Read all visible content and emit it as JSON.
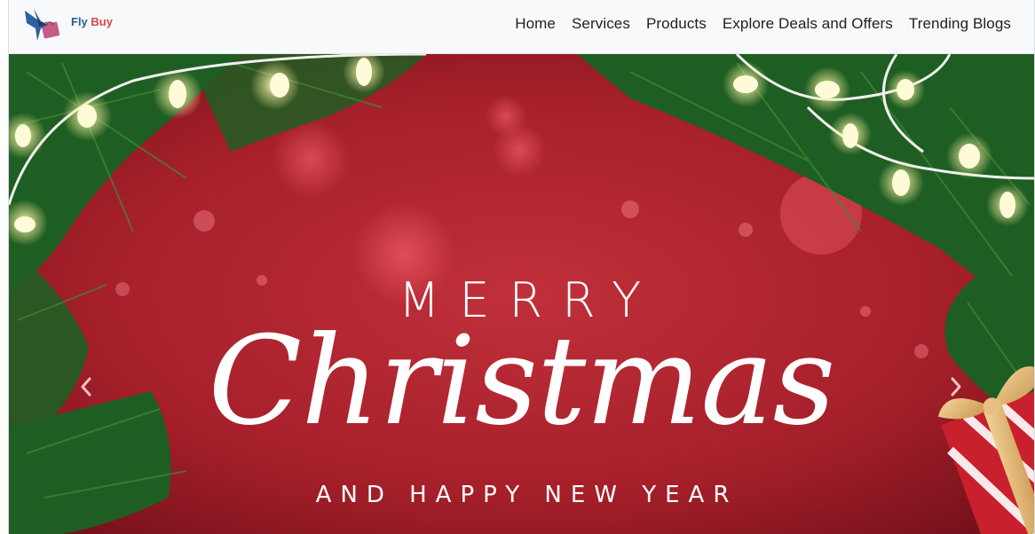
{
  "navbar": {
    "brand_first": "Fly",
    "brand_second": "Buy",
    "links": [
      "Home",
      "Services",
      "Products",
      "Explore Deals and Offers",
      "Trending Blogs"
    ]
  },
  "hero": {
    "line1": "MERRY",
    "line2": "Christmas",
    "line3": "AND HAPPY NEW YEAR",
    "prev_icon": "chevron-left-icon",
    "next_icon": "chevron-right-icon"
  },
  "colors": {
    "background_red": "#b0242e",
    "pine_green": "#1f5e22",
    "light_glow": "#fffbd0",
    "brand_blue": "#2c5d9b",
    "brand_red": "#d8464a"
  }
}
